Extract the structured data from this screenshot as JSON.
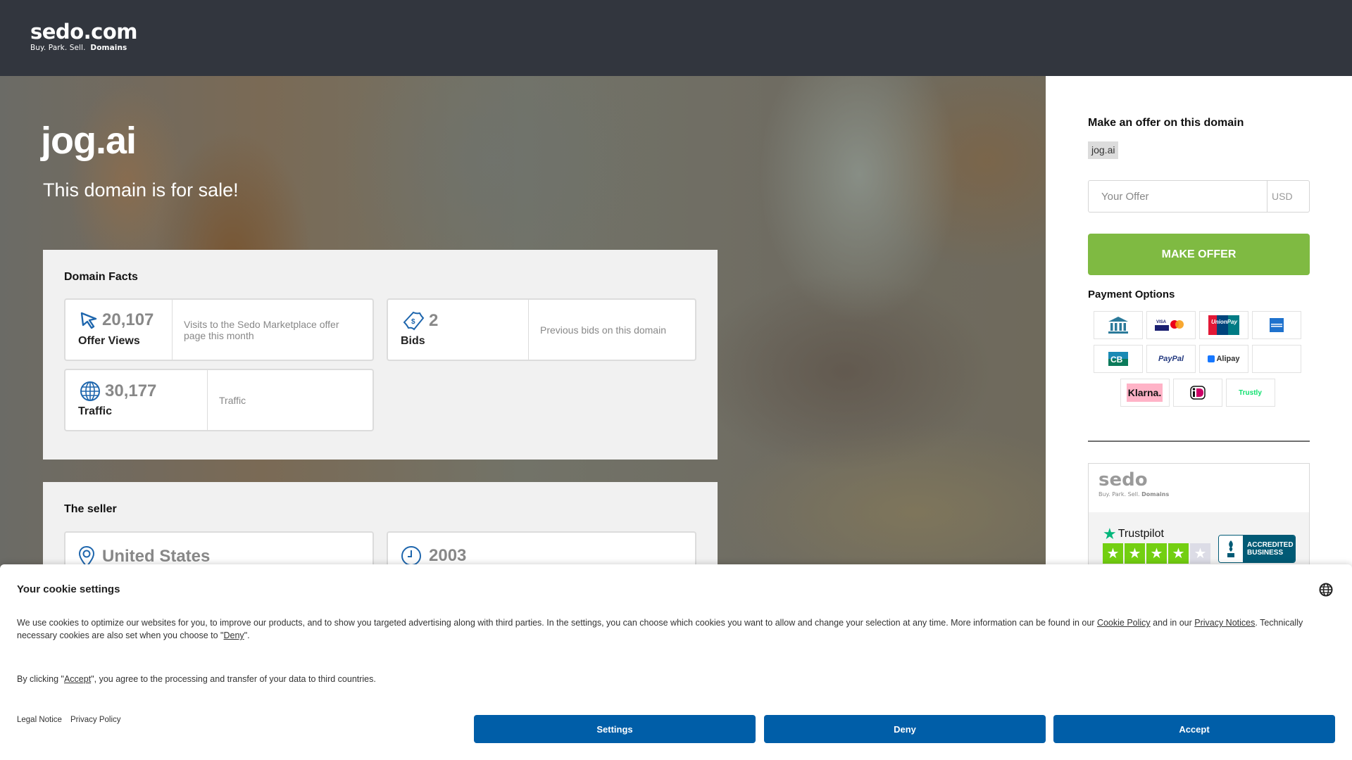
{
  "header": {
    "logo_main": "sedo.com",
    "logo_tag_plain": "Buy.  Park.  Sell.",
    "logo_tag_bold": "Domains"
  },
  "hero": {
    "domain": "jog.ai",
    "subtitle": "This domain is for sale!"
  },
  "domain_facts": {
    "title": "Domain Facts",
    "items": [
      {
        "icon": "cursor-icon",
        "value": "20,107",
        "label": "Offer Views",
        "description": "Visits to the Sedo Marketplace offer page this month"
      },
      {
        "icon": "money-tag-icon",
        "value": "2",
        "label": "Bids",
        "description": "Previous bids on this domain"
      },
      {
        "icon": "globe-icon",
        "value": "30,177",
        "label": "Traffic",
        "description": "Traffic"
      }
    ]
  },
  "seller": {
    "title": "The seller",
    "country": "United States",
    "member_since": "2003"
  },
  "sidebar": {
    "title": "Make an offer on this domain",
    "domain_chip": "jog.ai",
    "offer_placeholder": "Your Offer",
    "currency": "USD",
    "make_offer_label": "MAKE OFFER",
    "accent_color": "#7fba42",
    "payment_title": "Payment Options",
    "payment_methods": [
      "Bank Transfer",
      "Visa / Mastercard",
      "UnionPay",
      "American Express",
      "CB",
      "PayPal",
      "Alipay",
      "",
      "Klarna.",
      "iDEAL",
      "Trustly"
    ],
    "trust": {
      "logo": "sedo",
      "tag_plain": "Buy. Park. Sell.",
      "tag_bold": "Domains",
      "trustpilot_label": "Trustpilot",
      "trustpilot_stars": 4,
      "trustpilot_max": 5,
      "bbb_line1": "ACCREDITED",
      "bbb_line2": "BUSINESS"
    }
  },
  "cookie": {
    "title": "Your cookie settings",
    "text_part1": "We use cookies to optimize our websites for you, to improve our products, and to show you targeted advertising along with third parties. In the settings, you can choose which cookies you want to allow and change your selection at any time. More information can be found in our ",
    "cookie_policy_link": "Cookie Policy",
    "text_part2": " and in our ",
    "privacy_notices_link": "Privacy Notices",
    "text_part3": ". Technically necessary cookies are also set when you choose to \"",
    "deny_link": "Deny",
    "text_part4": "\".",
    "consent_part1": "By clicking \"",
    "accept_link": "Accept",
    "consent_part2": "\", you agree to the processing and transfer of your data to third countries.",
    "legal_notice": "Legal Notice",
    "privacy_policy": "Privacy Policy",
    "buttons": {
      "settings": "Settings",
      "deny": "Deny",
      "accept": "Accept"
    },
    "button_color": "#005ea8"
  }
}
